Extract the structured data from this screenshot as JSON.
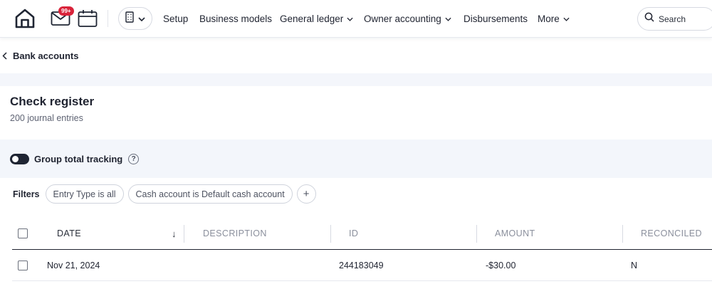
{
  "nav": {
    "mail_badge": "99+",
    "items": [
      {
        "label": "Setup"
      },
      {
        "label": "Business models"
      },
      {
        "label": "General ledger"
      },
      {
        "label": "Owner accounting"
      },
      {
        "label": "Disbursements"
      },
      {
        "label": "More"
      }
    ],
    "search_placeholder": "Search"
  },
  "breadcrumb": {
    "back_label": "Bank accounts"
  },
  "header": {
    "title": "Check register",
    "subtitle": "200 journal entries"
  },
  "toggle": {
    "label": "Group total tracking",
    "enabled": true,
    "help_glyph": "?"
  },
  "filters": {
    "label": "Filters",
    "chips": [
      "Entry Type is all",
      "Cash account is Default cash account"
    ],
    "add_glyph": "+"
  },
  "table": {
    "columns": [
      "DATE",
      "DESCRIPTION",
      "ID",
      "AMOUNT",
      "RECONCILED"
    ],
    "sort_indicator": "↓",
    "rows": [
      {
        "date": "Nov 21, 2024",
        "description": "",
        "id": "244183049",
        "amount": "-$30.00",
        "reconciled": "N"
      }
    ]
  },
  "colors": {
    "accent_dark": "#1f2533",
    "badge_red": "#d9233a",
    "band_bg": "#f3f6fb"
  },
  "icons": [
    "home-icon",
    "mail-icon",
    "calendar-icon",
    "building-icon",
    "chevron-down-icon",
    "search-icon",
    "chevron-left-icon",
    "help-icon"
  ]
}
